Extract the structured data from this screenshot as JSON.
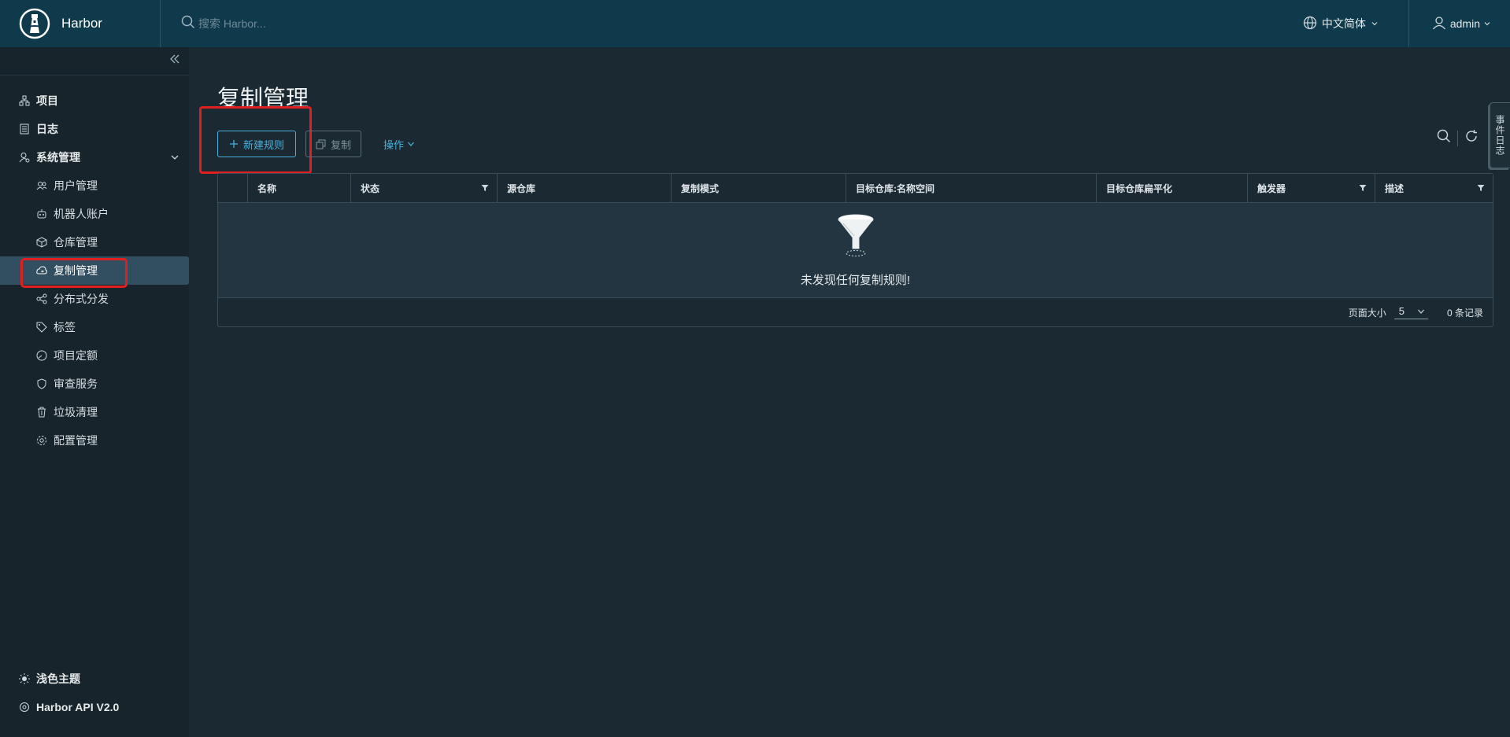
{
  "header": {
    "brand": "Harbor",
    "search_placeholder": "搜索 Harbor...",
    "language": "中文简体",
    "user": "admin"
  },
  "sidebar": {
    "items": [
      {
        "label": "项目",
        "icon": "projects-icon",
        "level": "top"
      },
      {
        "label": "日志",
        "icon": "logs-icon",
        "level": "top"
      },
      {
        "label": "系统管理",
        "icon": "admin-icon",
        "level": "top",
        "expanded": true
      }
    ],
    "children": [
      {
        "label": "用户管理",
        "icon": "users-icon"
      },
      {
        "label": "机器人账户",
        "icon": "robot-icon"
      },
      {
        "label": "仓库管理",
        "icon": "registry-icon"
      },
      {
        "label": "复制管理",
        "icon": "replication-icon",
        "active": true
      },
      {
        "label": "分布式分发",
        "icon": "share-icon"
      },
      {
        "label": "标签",
        "icon": "tag-icon"
      },
      {
        "label": "项目定额",
        "icon": "quota-icon"
      },
      {
        "label": "审查服务",
        "icon": "shield-icon"
      },
      {
        "label": "垃圾清理",
        "icon": "trash-icon"
      },
      {
        "label": "配置管理",
        "icon": "gear-icon"
      }
    ],
    "bottom": [
      {
        "label": "浅色主题",
        "icon": "sun-icon"
      },
      {
        "label": "Harbor API V2.0",
        "icon": "api-icon"
      }
    ]
  },
  "main": {
    "title": "复制管理",
    "toolbar": {
      "new_rule": "新建规则",
      "copy": "复制",
      "actions": "操作"
    },
    "columns": [
      "名称",
      "状态",
      "源仓库",
      "复制模式",
      "目标仓库:名称空间",
      "目标仓库扁平化",
      "触发器",
      "描述"
    ],
    "empty_text": "未发现任何复制规则!",
    "footer": {
      "page_size_label": "页面大小",
      "page_size": "5",
      "records": "0 条记录"
    },
    "side_tab": "事件日志"
  },
  "colors": {
    "header_bg": "#0f3a4c",
    "sidebar_bg": "#17242b",
    "main_bg": "#1b2a32",
    "accent": "#4aaed9",
    "highlight": "#e02020"
  }
}
